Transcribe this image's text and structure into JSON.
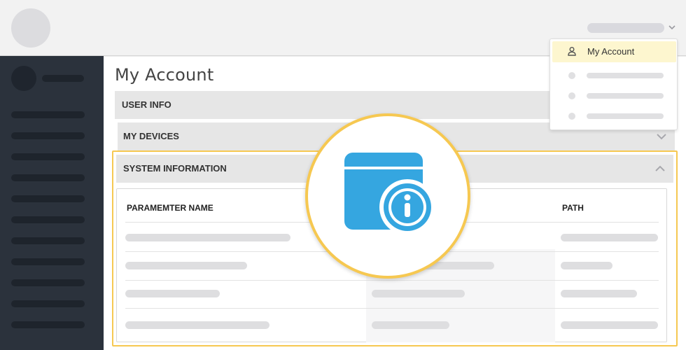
{
  "main": {
    "title": "My Account",
    "sections": [
      {
        "label": "USER INFO",
        "expanded": false
      },
      {
        "label": "MY DEVICES",
        "expanded": false
      },
      {
        "label": "SYSTEM INFORMATION",
        "expanded": true
      }
    ],
    "table": {
      "columns": [
        "PARAMEMTER NAME",
        "PATH"
      ]
    }
  },
  "dropdown": {
    "active_item": "My Account",
    "active_icon": "person-icon"
  },
  "badge": {
    "icon": "calendar-info-icon"
  },
  "colors": {
    "sidebar": "#2b323c",
    "highlight_border": "#f6c851",
    "dropdown_active": "#fdf6cf",
    "icon_blue": "#35a6e0"
  }
}
